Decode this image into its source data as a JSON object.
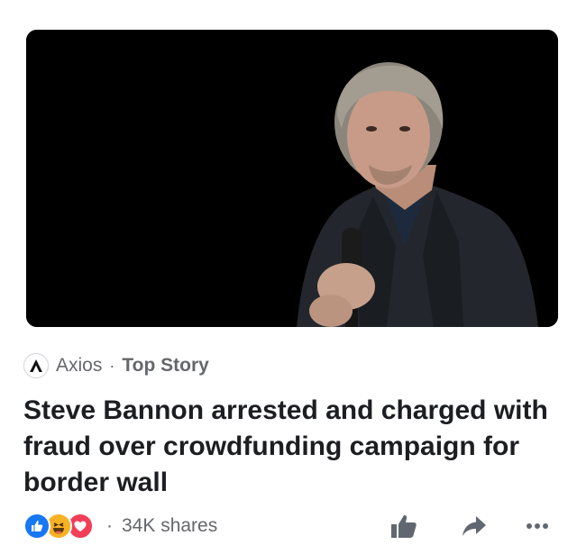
{
  "post": {
    "source_name": "Axios",
    "separator": "·",
    "source_tag": "Top Story",
    "headline": "Steve Bannon arrested and charged with fraud over crowdfunding campaign for border wall",
    "shares_separator": "·",
    "shares": "34K shares"
  },
  "reactions": [
    "like",
    "haha",
    "love"
  ],
  "icons": {
    "source_logo": "axios-logo-icon",
    "like": "thumbs-up-icon",
    "share": "share-arrow-icon",
    "more": "more-dots-icon"
  },
  "colors": {
    "like_reaction": "#1877f2",
    "haha_reaction": "#f7b125",
    "love_reaction": "#f33e58",
    "secondary_text": "#65676b",
    "action_icon": "#606770"
  }
}
